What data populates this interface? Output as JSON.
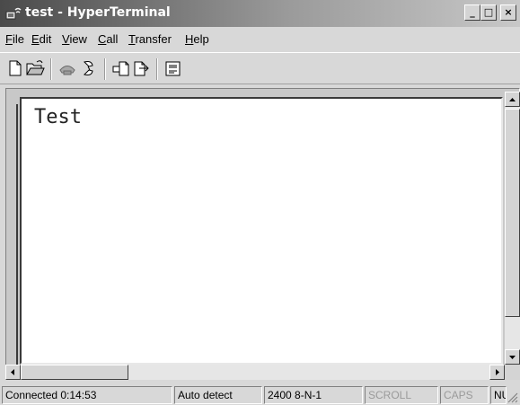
{
  "window": {
    "title_doc": "test",
    "title_sep": " - ",
    "title_app": "HyperTerminal",
    "minimize_glyph": "_",
    "maximize_glyph": "□",
    "close_glyph": "×"
  },
  "menu": [
    {
      "accel": "F",
      "rest": "ile"
    },
    {
      "accel": "E",
      "rest": "dit"
    },
    {
      "accel": "V",
      "rest": "iew"
    },
    {
      "accel": "C",
      "rest": "all"
    },
    {
      "accel": "T",
      "rest": "ransfer"
    },
    {
      "accel": "H",
      "rest": "elp"
    }
  ],
  "toolbar": {
    "icons": [
      "new-icon",
      "open-icon",
      "connect-icon",
      "disconnect-icon",
      "send-icon",
      "receive-icon",
      "properties-icon"
    ]
  },
  "terminal": {
    "text": "Test"
  },
  "status": {
    "connection": "Connected 0:14:53",
    "detect": "Auto detect",
    "settings": "2400 8-N-1",
    "scroll": "SCROLL",
    "caps": "CAPS",
    "num": "NUM"
  }
}
